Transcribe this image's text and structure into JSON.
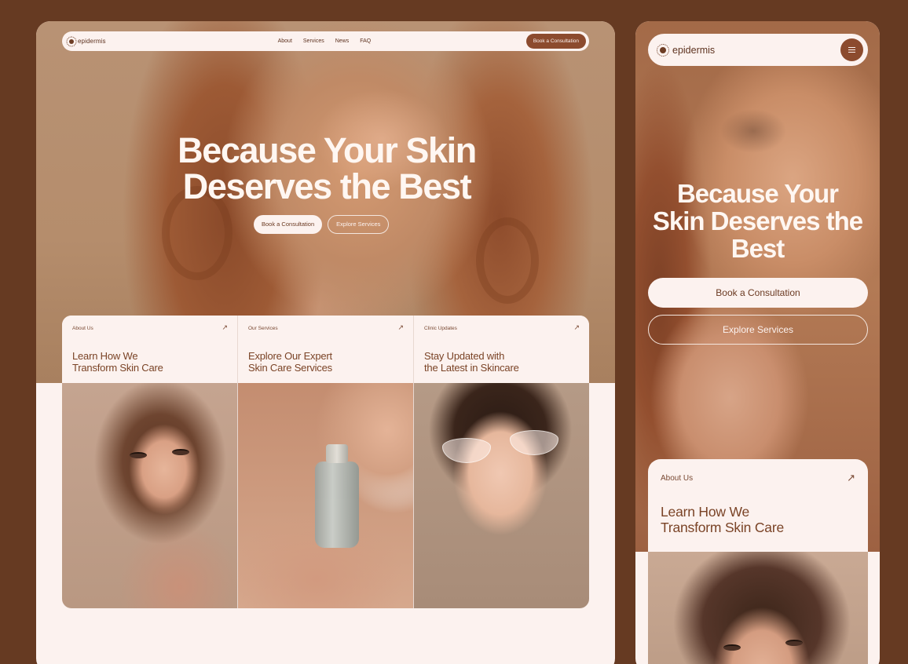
{
  "brand": {
    "name": "epidermis"
  },
  "desktop": {
    "nav": {
      "links": [
        "About",
        "Services",
        "News",
        "FAQ"
      ],
      "cta": "Book a Consultation"
    },
    "hero": {
      "title_line1": "Because Your Skin",
      "title_line2": "Deserves the Best",
      "primary_button": "Book a Consultation",
      "secondary_button": "Explore Services"
    },
    "cards": [
      {
        "label": "About Us",
        "title_line1": "Learn How We",
        "title_line2": "Transform Skin Care",
        "arrow": "↗"
      },
      {
        "label": "Our Services",
        "title_line1": "Explore Our Expert",
        "title_line2": "Skin Care Services",
        "arrow": "↗"
      },
      {
        "label": "Clinic Updates",
        "title_line1": "Stay Updated with",
        "title_line2": "the Latest in Skincare",
        "arrow": "↗"
      }
    ]
  },
  "mobile": {
    "hero": {
      "title_line1": "Because Your",
      "title_line2": "Skin Deserves the",
      "title_line3": "Best",
      "primary_button": "Book a Consultation",
      "secondary_button": "Explore Services"
    },
    "card": {
      "label": "About Us",
      "title_line1": "Learn How We",
      "title_line2": "Transform Skin Care",
      "arrow": "↗"
    }
  },
  "colors": {
    "background": "#663a22",
    "cream": "#fcf2ef",
    "accent": "#8c4b2e",
    "text_brown": "#7a4326"
  },
  "icons": [
    "sun-logo-icon",
    "arrow-up-right-icon",
    "hamburger-menu-icon"
  ]
}
